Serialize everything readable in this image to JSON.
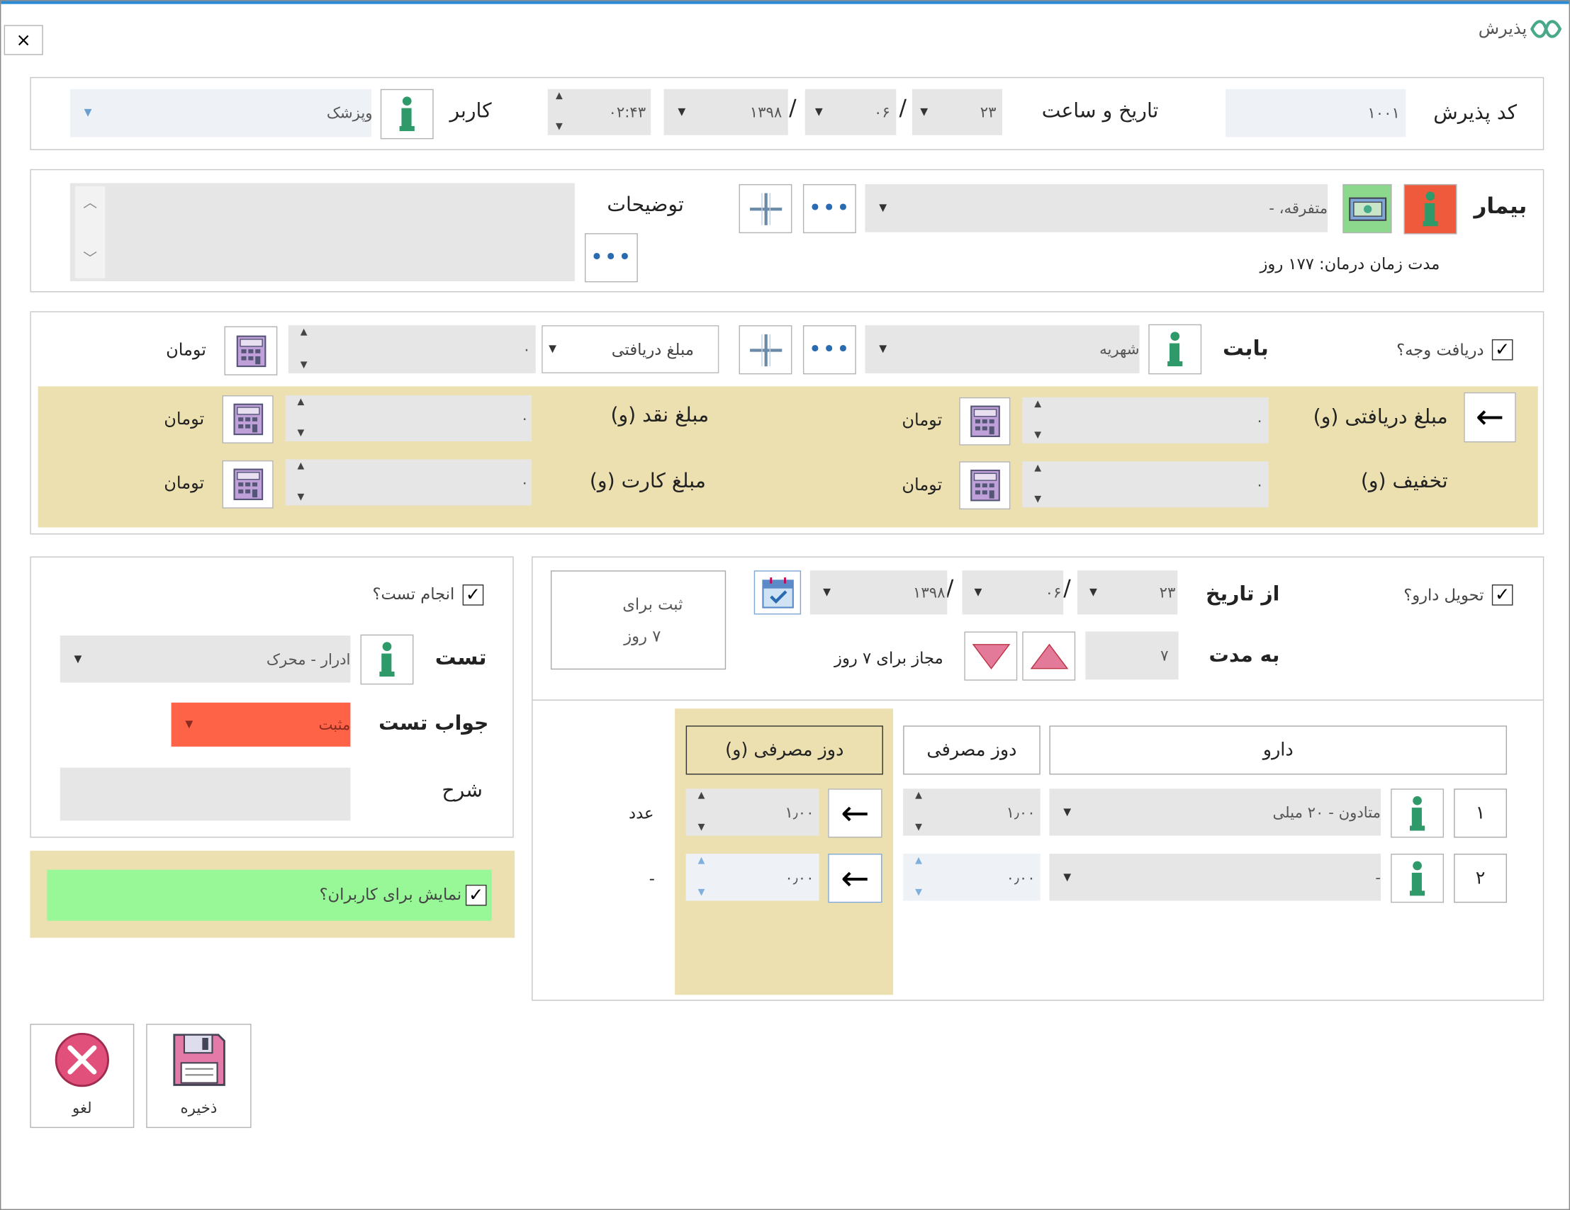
{
  "window": {
    "title": "پذیرش",
    "close": "×"
  },
  "header": {
    "code_label": "کد پذیرش",
    "code_value": "۱۰۰۱",
    "datetime_label": "تاریخ و ساعت",
    "date_day": "۲۳",
    "date_month": "۰۶",
    "date_year": "۱۳۹۸",
    "date_sep": "/",
    "time": "۰۲:۴۳",
    "user_label": "کاربر",
    "user_value": "وپزشک"
  },
  "patient": {
    "label": "بیمار",
    "value": "متفرقه، -",
    "treatment_duration": "مدت زمان درمان: ۱۷۷ روز",
    "notes_label": "توضیحات"
  },
  "payment": {
    "receive_checkbox_label": "دریافت وجه؟",
    "subject_label": "بابت",
    "subject_value": "شهریه",
    "amount_type_value": "مبلغ دریافتی",
    "amount_value": "۰",
    "currency": "تومان",
    "received_label": "مبلغ دریافتی (و)",
    "received_value": "۰",
    "cash_label": "مبلغ نقد (و)",
    "cash_value": "۰",
    "discount_label": "تخفیف (و)",
    "discount_value": "۰",
    "card_label": "مبلغ کارت (و)",
    "card_value": "۰"
  },
  "drug": {
    "delivery_checkbox_label": "تحویل دارو؟",
    "from_date_label": "از تاریخ",
    "from_day": "۲۳",
    "from_month": "۰۶",
    "from_year": "۱۳۹۸",
    "register_line1": "ثبت  برای",
    "register_line2": "۷ روز",
    "duration_label": "به مدت",
    "duration_value": "۷",
    "allowed_text": "مجاز برای ۷ روز",
    "col_drug": "دارو",
    "col_dose": "دوز مصرفی",
    "col_dose_v": "دوز مصرفی (و)",
    "rows": [
      {
        "num": "۱",
        "drug": "متادون - ۲۰ میلی",
        "dose": "۱٫۰۰",
        "dose_v": "۱٫۰۰",
        "unit": "عدد"
      },
      {
        "num": "۲",
        "drug": "-",
        "dose": "۰٫۰۰",
        "dose_v": "۰٫۰۰",
        "unit": "-"
      }
    ]
  },
  "test": {
    "do_test_label": "انجام تست؟",
    "test_label": "تست",
    "test_value": "ادرار - محرک",
    "answer_label": "جواب تست",
    "answer_value": "مثبت",
    "desc_label": "شرح",
    "answer_color": "#ff6347"
  },
  "show_users": {
    "label": "نمایش برای کاربران؟"
  },
  "actions": {
    "save": "ذخیره",
    "cancel": "لغو"
  },
  "colors": {
    "panel_beige": "#ece0b0",
    "panel_green": "#98f898",
    "accent_blue": "#2a8ad4"
  }
}
